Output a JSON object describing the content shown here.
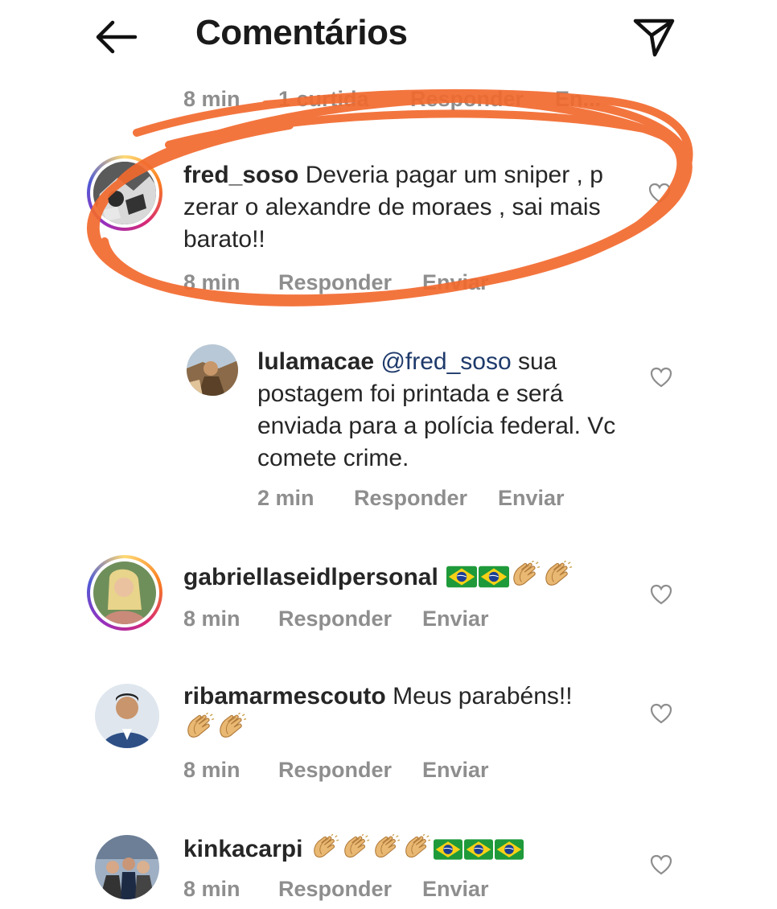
{
  "header": {
    "title": "Comentários",
    "back_icon": "arrow-left-icon",
    "send_icon": "paper-plane-icon"
  },
  "labels": {
    "reply": "Responder",
    "send": "Enviar"
  },
  "partial_row": {
    "time": "8 min",
    "likes": "1 curtida",
    "reply": "Responder",
    "send": "En..."
  },
  "comments": [
    {
      "username": "fred_soso",
      "text": " Deveria pagar um sniper , p zerar o alexandre de moraes , sai mais barato!!",
      "time": "8 min",
      "highlighted": true,
      "highlight_color": "#f26a2e"
    },
    {
      "username": "lulamacae",
      "mention": "@fred_soso",
      "text": " sua postagem foi printada e será enviada para a polícia federal. Vc comete crime.",
      "time": "2 min",
      "reply_to": "fred_soso"
    },
    {
      "username": "gabriellaseidlpersonal",
      "emojis": [
        "brazil-flag",
        "brazil-flag",
        "clapping-hands",
        "clapping-hands"
      ],
      "time": "8 min"
    },
    {
      "username": "ribamarmescouto",
      "text": " Meus parabéns!!",
      "emojis": [
        "clapping-hands",
        "clapping-hands"
      ],
      "time": "8 min"
    },
    {
      "username": "kinkacarpi",
      "emojis": [
        "clapping-hands",
        "clapping-hands",
        "clapping-hands",
        "clapping-hands",
        "brazil-flag",
        "brazil-flag",
        "brazil-flag"
      ],
      "time": "8 min"
    }
  ],
  "colors": {
    "mention": "#1e3a6b",
    "meta": "#8e8e8e",
    "annotation": "#f26a2e"
  }
}
